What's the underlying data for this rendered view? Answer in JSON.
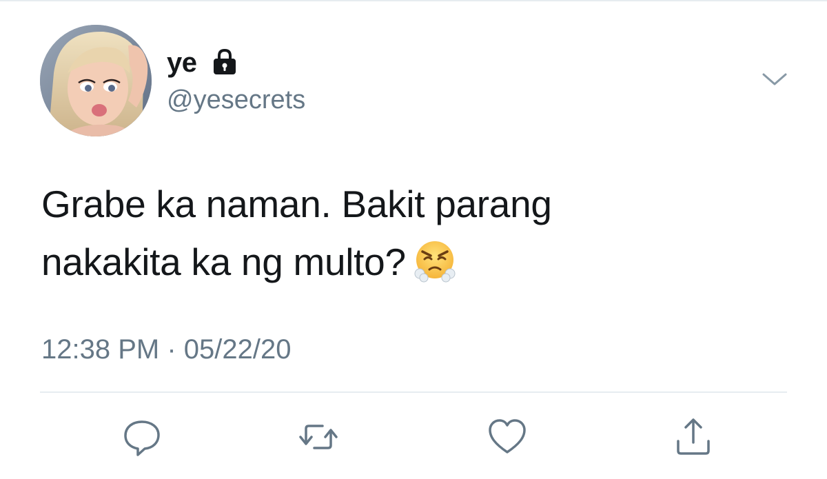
{
  "tweet": {
    "display_name": "ye",
    "handle": "@yesecrets",
    "text_line1": "Grabe ka naman. Bakit parang",
    "text_line2": "nakakita ka ng multo?",
    "timestamp": "12:38 PM · 05/22/20"
  },
  "icons": {
    "lock": "lock-icon",
    "chevron": "chevron-down-icon",
    "emoji": "face-with-steam-from-nose-icon",
    "reply": "reply-icon",
    "retweet": "retweet-icon",
    "like": "heart-icon",
    "share": "share-icon"
  },
  "colors": {
    "text_primary": "#14171a",
    "text_secondary": "#657786",
    "icon": "#657786",
    "divider": "#e6ecf0"
  }
}
